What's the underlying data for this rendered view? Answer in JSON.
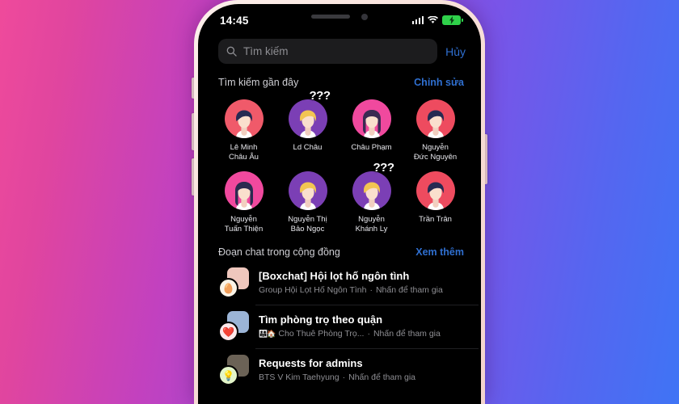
{
  "statusbar": {
    "time": "14:45",
    "signal_icon": "signal-bars-icon",
    "wifi_icon": "wifi-icon",
    "battery_icon": "battery-charging-icon"
  },
  "search": {
    "placeholder": "Tìm kiếm",
    "icon": "search-icon",
    "cancel_label": "Hủy"
  },
  "recent": {
    "title": "Tìm kiếm gần đây",
    "action_label": "Chỉnh sửa",
    "items": [
      {
        "name": "Lê Minh\nChâu Âu",
        "bg": "#f05a6a",
        "hair": "#262a52",
        "hair_style": "short",
        "badge": ""
      },
      {
        "name": "Ld Châu",
        "bg": "#7b3fb5",
        "hair": "#f2c552",
        "hair_style": "short",
        "badge": "???"
      },
      {
        "name": "Châu Phạm",
        "bg": "#f0499e",
        "hair": "#3a2a52",
        "hair_style": "long",
        "badge": ""
      },
      {
        "name": "Nguyễn\nĐức Nguyên",
        "bg": "#ee4b5f",
        "hair": "#262a52",
        "hair_style": "short",
        "badge": ""
      },
      {
        "name": "Nguyễn\nTuấn Thiện",
        "bg": "#f0499e",
        "hair": "#2b2a50",
        "hair_style": "long",
        "badge": ""
      },
      {
        "name": "Nguyễn Thị\nBảo Ngọc",
        "bg": "#7b3fb5",
        "hair": "#f2c552",
        "hair_style": "short",
        "badge": ""
      },
      {
        "name": "Nguyễn\nKhánh Ly",
        "bg": "#7b3fb5",
        "hair": "#f2c552",
        "hair_style": "short",
        "badge": "???"
      },
      {
        "name": "Trần Trân",
        "bg": "#ee4b5f",
        "hair": "#262a52",
        "hair_style": "short",
        "badge": ""
      }
    ]
  },
  "community": {
    "title": "Đoạn chat trong cộng đồng",
    "action_label": "Xem thêm",
    "rows": [
      {
        "title": "[Boxchat] Hội lọt hố ngôn tình",
        "group": "Group Hội Lọt Hố Ngôn Tình",
        "separator": "·",
        "join_label": "Nhấn để tham gia",
        "faces": "",
        "thumb_back_color": "#efc7bd",
        "thumb_front_color": "#fbf4e8",
        "thumb_front_glyph": "🥚"
      },
      {
        "title": "Tìm phòng trọ theo quận",
        "group": "Cho Thuê Phòng Trọ...",
        "separator": "·",
        "join_label": "Nhấn để tham gia",
        "faces": "👨‍👩‍👧🏠",
        "thumb_back_color": "#9bb4d6",
        "thumb_front_color": "#fde8ea",
        "thumb_front_glyph": "❤️"
      },
      {
        "title": "Requests for admins",
        "group": "BTS V Kim Taehyung",
        "separator": "·",
        "join_label": "Nhấn để tham gia",
        "faces": "",
        "thumb_back_color": "#6b6256",
        "thumb_front_color": "#e3f5c9",
        "thumb_front_glyph": "💡"
      }
    ]
  }
}
